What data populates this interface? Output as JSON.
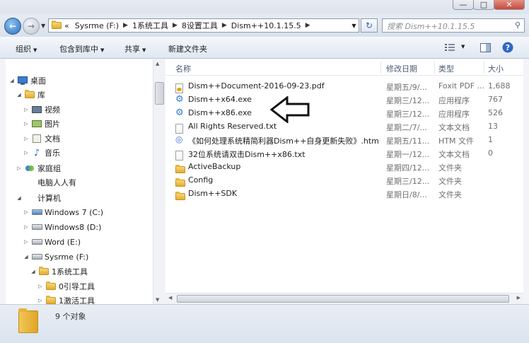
{
  "address": {
    "crumbs": [
      "Sysrme (F:)",
      "1系统工具",
      "8设置工具",
      "Dism++10.1.15.5"
    ],
    "prefix": "«"
  },
  "search": {
    "placeholder": "搜索 Dism++10.1.15.5"
  },
  "toolbar": {
    "organize": "组织",
    "include_library": "包含到库中",
    "share": "共享",
    "new_folder": "新建文件夹"
  },
  "nav": {
    "items": [
      {
        "label": "桌面"
      },
      {
        "label": "库"
      },
      {
        "label": "视频"
      },
      {
        "label": "图片"
      },
      {
        "label": "文档"
      },
      {
        "label": "音乐"
      },
      {
        "label": "家庭组"
      },
      {
        "label": "电脑人人有"
      },
      {
        "label": "计算机"
      },
      {
        "label": "Windows 7  (C:)"
      },
      {
        "label": "Windows8 (D:)"
      },
      {
        "label": "Word (E:)"
      },
      {
        "label": "Sysrme (F:)"
      },
      {
        "label": "1系统工具"
      },
      {
        "label": "0引导工具"
      },
      {
        "label": "1激活工具"
      }
    ]
  },
  "columns": {
    "name": "名称",
    "date": "修改日期",
    "type": "类型",
    "size": "大小"
  },
  "files": [
    {
      "name": "Dism++Document-2016-09-23.pdf",
      "date": "星期五/9/...",
      "type": "Foxit PDF ...",
      "size": "1,688",
      "icon": "pdf-icon"
    },
    {
      "name": "Dism++x64.exe",
      "date": "星期三/12...",
      "type": "应用程序",
      "size": "767",
      "icon": "gear-icon"
    },
    {
      "name": "Dism++x86.exe",
      "date": "星期三/12...",
      "type": "应用程序",
      "size": "526",
      "icon": "gear-icon"
    },
    {
      "name": "All Rights Reserved.txt",
      "date": "星期二/7/...",
      "type": "文本文档",
      "size": "13",
      "icon": "text-file-icon"
    },
    {
      "name": "《如何处理系统精简利器Dism++自身更新失败》.htm",
      "date": "星期五/11...",
      "type": "HTM 文件",
      "size": "1",
      "icon": "htm-icon"
    },
    {
      "name": "32位系统请双击Dism++x86.txt",
      "date": "星期一/12...",
      "type": "文本文档",
      "size": "0",
      "icon": "text-file-icon"
    },
    {
      "name": "ActiveBackup",
      "date": "星期四/12...",
      "type": "文件夹",
      "size": "",
      "icon": "folder-icon"
    },
    {
      "name": "Config",
      "date": "星期三/12...",
      "type": "文件夹",
      "size": "",
      "icon": "folder-icon"
    },
    {
      "name": "Dism++SDK",
      "date": "星期日/8/...",
      "type": "文件夹",
      "size": "",
      "icon": "folder-icon"
    }
  ],
  "status": {
    "count": "9 个对象"
  },
  "colors": {
    "accent": "#2c6fbe",
    "folder": "#e9b43a"
  }
}
